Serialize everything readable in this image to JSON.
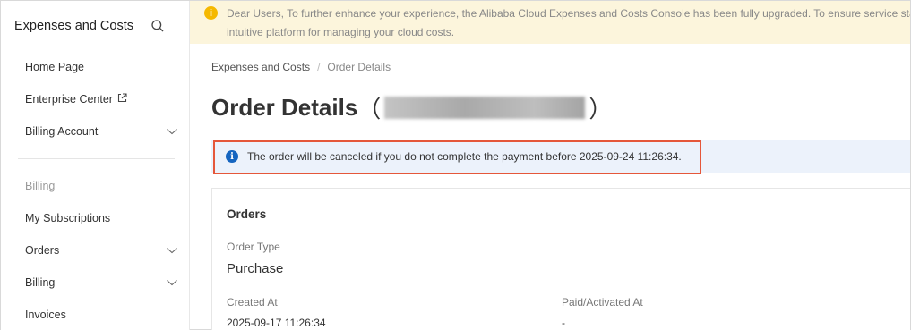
{
  "sidebar": {
    "title": "Expenses and Costs",
    "items": [
      {
        "label": "Home Page"
      },
      {
        "label": "Enterprise Center"
      },
      {
        "label": "Billing Account"
      }
    ],
    "group_label": "Billing",
    "group_items": [
      {
        "label": "My Subscriptions"
      },
      {
        "label": "Orders"
      },
      {
        "label": "Billing"
      },
      {
        "label": "Invoices"
      }
    ]
  },
  "notice": {
    "line1": "Dear Users, To further enhance your experience, the Alibaba Cloud Expenses and Costs Console has been fully upgraded. To ensure service stabili",
    "line2": "intuitive platform for managing your cloud costs."
  },
  "breadcrumb": {
    "parent": "Expenses and Costs",
    "separator": "/",
    "current": "Order Details"
  },
  "page": {
    "title": "Order Details",
    "open_paren": "（",
    "close_paren": "）"
  },
  "alert": {
    "message": "The order will be canceled if you do not complete the payment before 2025-09-24 11:26:34."
  },
  "orders_card": {
    "title": "Orders",
    "order_type_label": "Order Type",
    "order_type_value": "Purchase",
    "created_at_label": "Created At",
    "created_at_value": "2025-09-17 11:26:34",
    "paid_label": "Paid/Activated At",
    "paid_value": "-"
  },
  "colors": {
    "notice_bg": "#fcf5dc",
    "info_bg": "#ecf2fb",
    "highlight": "#e5573a",
    "info_icon": "#1565c0"
  }
}
